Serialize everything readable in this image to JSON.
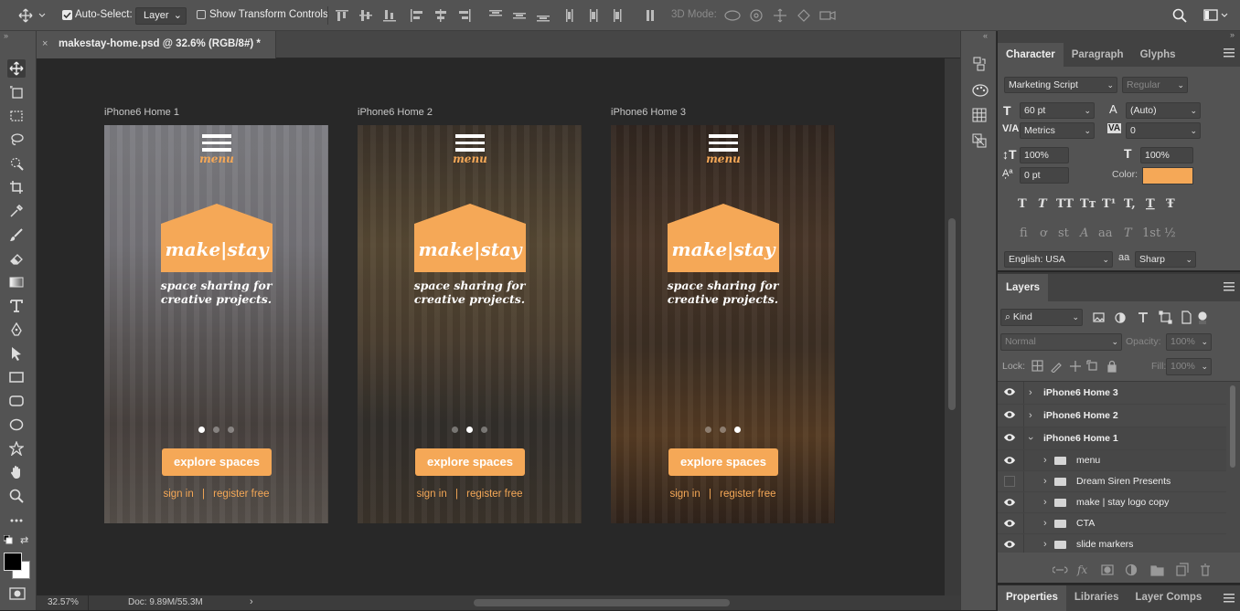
{
  "options_bar": {
    "auto_select_label": "Auto-Select:",
    "auto_select_value": "Layer",
    "show_transform_label": "Show Transform Controls",
    "mode3d_label": "3D Mode:"
  },
  "document": {
    "tab_title": "makestay-home.psd @ 32.6% (RGB/8#) *"
  },
  "artboards": [
    {
      "label": "iPhone6 Home 1",
      "menu_text": "menu",
      "logo": "make|stay",
      "tag1": "space sharing for",
      "tag2": "creative projects.",
      "cta": "explore spaces",
      "signin": "sign in",
      "sep": "|",
      "register": "register free",
      "active_dot": 0
    },
    {
      "label": "iPhone6 Home 2",
      "menu_text": "menu",
      "logo": "make|stay",
      "tag1": "space sharing for",
      "tag2": "creative projects.",
      "cta": "explore spaces",
      "signin": "sign in",
      "sep": "|",
      "register": "register free",
      "active_dot": 1
    },
    {
      "label": "iPhone6 Home 3",
      "menu_text": "menu",
      "logo": "make|stay",
      "tag1": "space sharing for",
      "tag2": "creative projects.",
      "cta": "explore spaces",
      "signin": "sign in",
      "sep": "|",
      "register": "register free",
      "active_dot": 2
    }
  ],
  "status": {
    "zoom": "32.57%",
    "doc": "Doc: 9.89M/55.3M"
  },
  "character_panel": {
    "tabs": [
      "Character",
      "Paragraph",
      "Glyphs"
    ],
    "font_family": "Marketing Script",
    "font_style": "Regular",
    "font_size": "60 pt",
    "leading": "(Auto)",
    "kerning": "Metrics",
    "tracking": "0",
    "vscale": "100%",
    "hscale": "100%",
    "baseline": "0 pt",
    "color_label": "Color:",
    "color": "#f5a857",
    "language": "English: USA",
    "aa_prefix": "aa",
    "antialias": "Sharp"
  },
  "layers_panel": {
    "title": "Layers",
    "kind": "Kind",
    "blend": "Normal",
    "opacity_label": "Opacity:",
    "opacity": "100%",
    "lock_label": "Lock:",
    "fill_label": "Fill:",
    "fill": "100%",
    "layers": [
      {
        "name": "iPhone6 Home 3",
        "visible": true,
        "group": "artboard",
        "expanded": false
      },
      {
        "name": "iPhone6 Home 2",
        "visible": true,
        "group": "artboard",
        "expanded": false
      },
      {
        "name": "iPhone6 Home 1",
        "visible": true,
        "group": "artboard",
        "expanded": true
      },
      {
        "name": "menu",
        "visible": true,
        "group": "folder",
        "expanded": false
      },
      {
        "name": "Dream Siren Presents",
        "visible": false,
        "group": "folder",
        "expanded": false
      },
      {
        "name": "make | stay logo copy",
        "visible": true,
        "group": "folder",
        "expanded": false
      },
      {
        "name": "CTA",
        "visible": true,
        "group": "folder",
        "expanded": false
      },
      {
        "name": "slide markers",
        "visible": true,
        "group": "folder",
        "expanded": false
      }
    ]
  },
  "bottom_tabs": [
    "Properties",
    "Libraries",
    "Layer Comps"
  ]
}
